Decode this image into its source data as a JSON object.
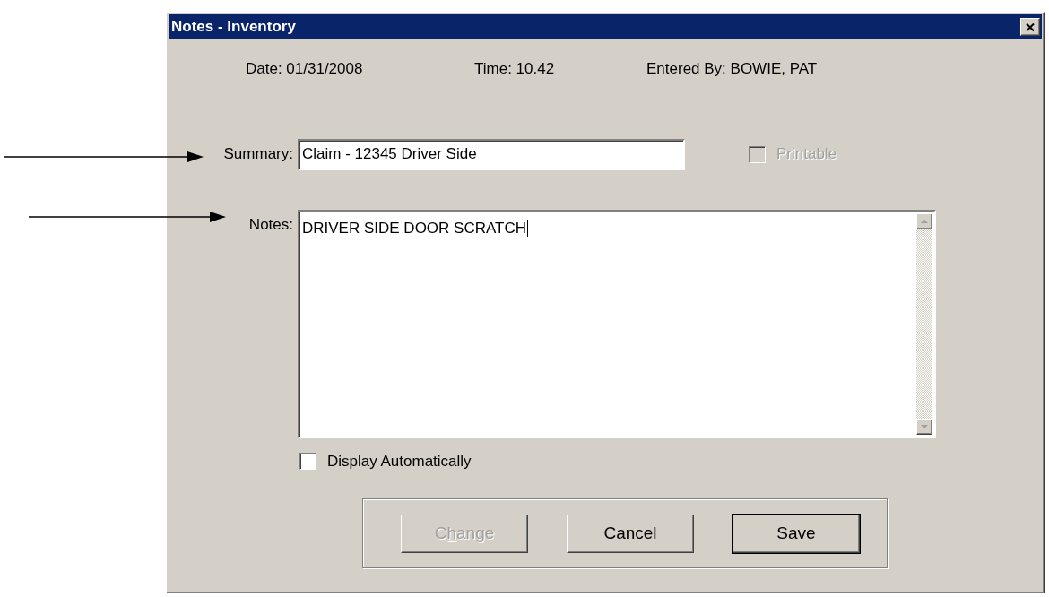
{
  "window": {
    "title": "Notes - Inventory"
  },
  "info": [
    "Date: 01/31/2008",
    "Time: 10.42",
    "Entered By: BOWIE, PAT"
  ],
  "summary": {
    "label": "Summary:",
    "value": "Claim - 12345 Driver Side"
  },
  "printable": {
    "label": "Printable",
    "checked": false,
    "disabled": true
  },
  "notes": {
    "label": "Notes:",
    "value": "DRIVER SIDE DOOR SCRATCH",
    "focused": true
  },
  "display_automatically": {
    "label": "Display Automatically",
    "checked": false,
    "disabled": false
  },
  "buttons": [
    {
      "label_before_key": "C",
      "access_key": "h",
      "label_after_key": "ange",
      "disabled": true,
      "default": false
    },
    {
      "access_key": "C",
      "label_after_key": "ancel",
      "disabled": false,
      "default": false
    },
    {
      "access_key": "S",
      "label_after_key": "ave",
      "disabled": false,
      "default": true
    }
  ]
}
